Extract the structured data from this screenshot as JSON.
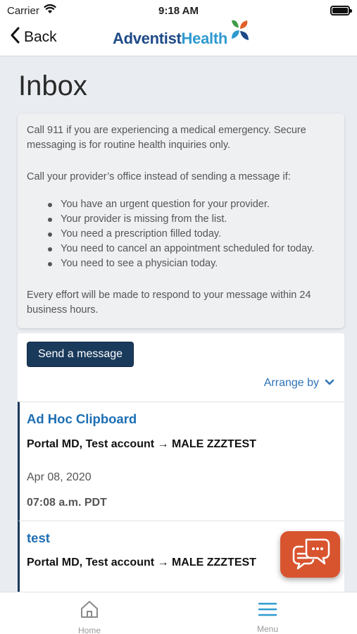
{
  "status_bar": {
    "carrier": "Carrier",
    "time": "9:18 AM"
  },
  "nav": {
    "back_label": "Back",
    "logo_text_primary": "Adventist",
    "logo_text_secondary": "Health"
  },
  "page": {
    "title": "Inbox"
  },
  "notice": {
    "intro": "Call 911 if you are experiencing a medical emergency. Secure messaging is for routine health inquiries only.",
    "call_instead": "Call your provider’s office instead of sending a message if:",
    "bullets": [
      "You have an urgent question for your provider.",
      "Your provider is missing from the list.",
      "You need a prescription filled today.",
      "You need to cancel an appointment scheduled for today.",
      "You need to see a physician today."
    ],
    "footer": "Every effort will be made to respond to your message within 24 business hours."
  },
  "actions": {
    "send_message": "Send a message",
    "arrange_by": "Arrange by"
  },
  "messages": [
    {
      "subject": "Ad Hoc Clipboard",
      "route": "Portal MD, Test account → MALE ZZZTEST",
      "date": "Apr 08, 2020",
      "time": "07:08 a.m. PDT"
    },
    {
      "subject": "test",
      "route": "Portal MD, Test account → MALE ZZZTEST"
    }
  ],
  "tab_bar": {
    "home": "Home",
    "menu": "Menu"
  },
  "colors": {
    "brand_navy": "#1a3a5c",
    "link_blue": "#1d6eb3",
    "chat_orange": "#d8542f"
  }
}
